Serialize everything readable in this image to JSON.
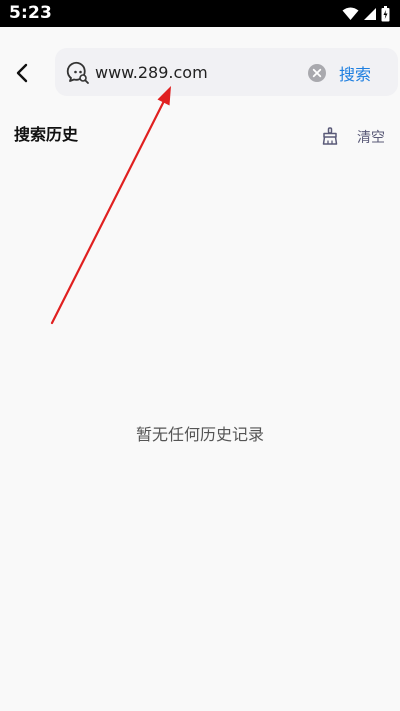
{
  "status_bar": {
    "time": "5:23",
    "icons": [
      "wifi-icon",
      "signal-icon",
      "battery-icon"
    ]
  },
  "header": {
    "back_icon": "chevron-left-icon",
    "search": {
      "icon": "search-icon",
      "value": "www.289.com",
      "clear_icon": "clear-icon",
      "button_label": "搜索"
    }
  },
  "history": {
    "title": "搜索历史",
    "clear_icon": "broom-icon",
    "clear_label": "清空",
    "empty_text": "暂无任何历史记录"
  },
  "colors": {
    "accent": "#1e7fe0",
    "annotation_arrow": "#e02020"
  }
}
